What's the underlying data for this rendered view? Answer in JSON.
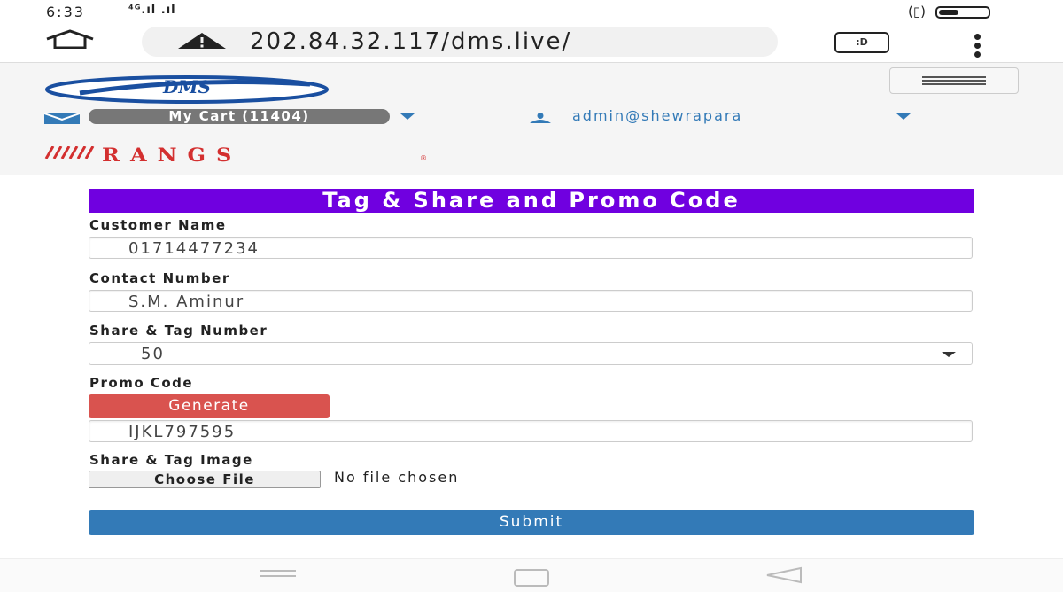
{
  "status_bar": {
    "time": "6:33",
    "signal": "⁴ᴳ.ıl .ıl",
    "vibrate": "(▯)"
  },
  "browser": {
    "url": "202.84.32.117/dms.live/"
  },
  "header": {
    "logo_text": "DMS",
    "cart_label": "My Cart (11404)",
    "user_label": "admin@shewrapara",
    "brand_name": "RANGS",
    "brand_reg": "®"
  },
  "form": {
    "title": "Tag & Share and Promo Code",
    "customer_name_label": "Customer Name",
    "customer_name_value": "01714477234",
    "contact_number_label": "Contact Number",
    "contact_number_value": "S.M. Aminur",
    "share_tag_number_label": "Share & Tag Number",
    "share_tag_number_value": "50",
    "promo_code_label": "Promo Code",
    "generate_label": "Generate",
    "promo_code_value": "IJKL797595",
    "share_tag_image_label": "Share & Tag Image",
    "choose_file_label": "Choose File",
    "file_status": "No file chosen",
    "submit_label": "Submit"
  },
  "colors": {
    "title_bg": "#7000e0",
    "generate_bg": "#d9534f",
    "submit_bg": "#337ab7",
    "brand_red": "#d32f2f"
  }
}
